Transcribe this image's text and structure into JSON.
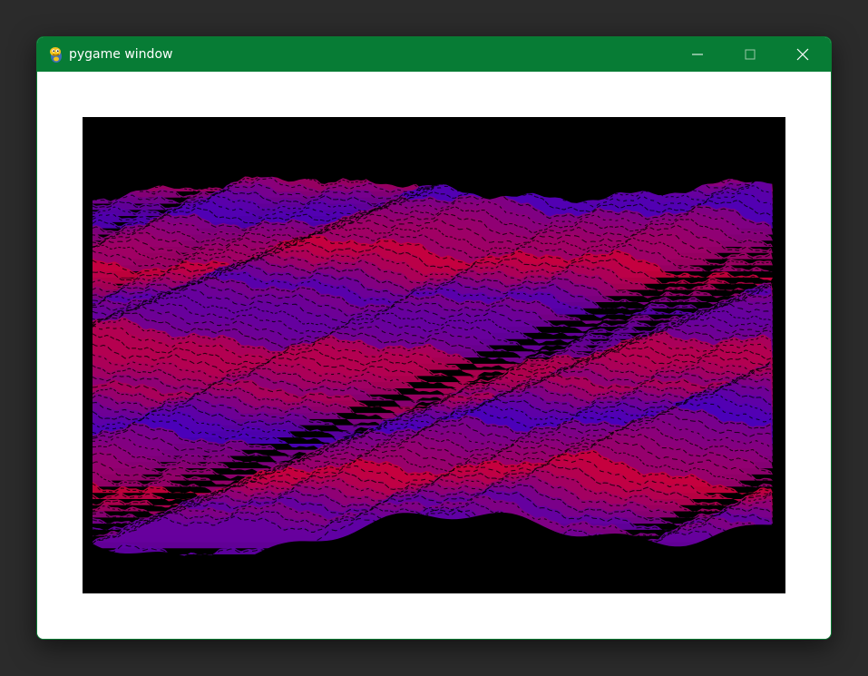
{
  "window": {
    "title": "pygame window",
    "titlebar_color": "#077c35",
    "app_icon": "pygame-snake-icon",
    "controls": {
      "minimize_icon": "minimize-icon",
      "maximize_icon": "maximize-icon",
      "close_icon": "close-icon"
    }
  },
  "canvas": {
    "background": "#000000",
    "colors": {
      "red": "#c8003c",
      "blue": "#3c00c8"
    }
  }
}
